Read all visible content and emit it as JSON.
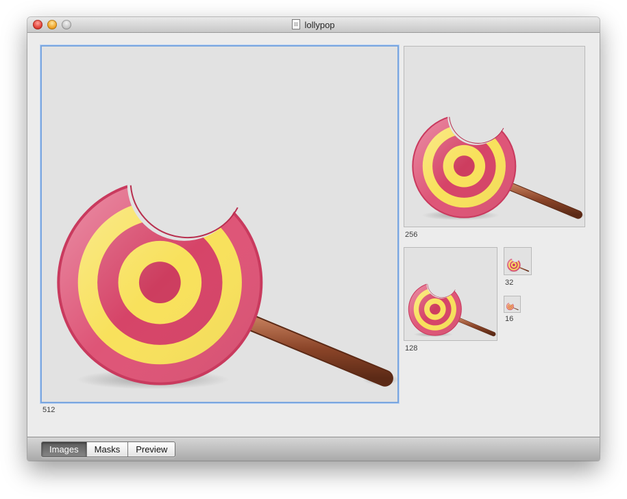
{
  "window": {
    "title": "lollypop",
    "title_icon": "document-icon",
    "controls": [
      "close-button",
      "minimize-button",
      "zoom-button"
    ]
  },
  "image_wells": [
    {
      "size_label": "512",
      "selected": true
    },
    {
      "size_label": "256",
      "selected": false
    },
    {
      "size_label": "128",
      "selected": false
    },
    {
      "size_label": "32",
      "selected": false
    },
    {
      "size_label": "16",
      "selected": false
    }
  ],
  "tabs": [
    {
      "label": "Images",
      "active": true
    },
    {
      "label": "Masks",
      "active": false
    },
    {
      "label": "Preview",
      "active": false
    }
  ],
  "colors": {
    "candy_pink": "#d64468",
    "candy_yellow": "#fbe35c",
    "stick_brown": "#7a3c22",
    "selection_blue": "#7aa6df"
  }
}
